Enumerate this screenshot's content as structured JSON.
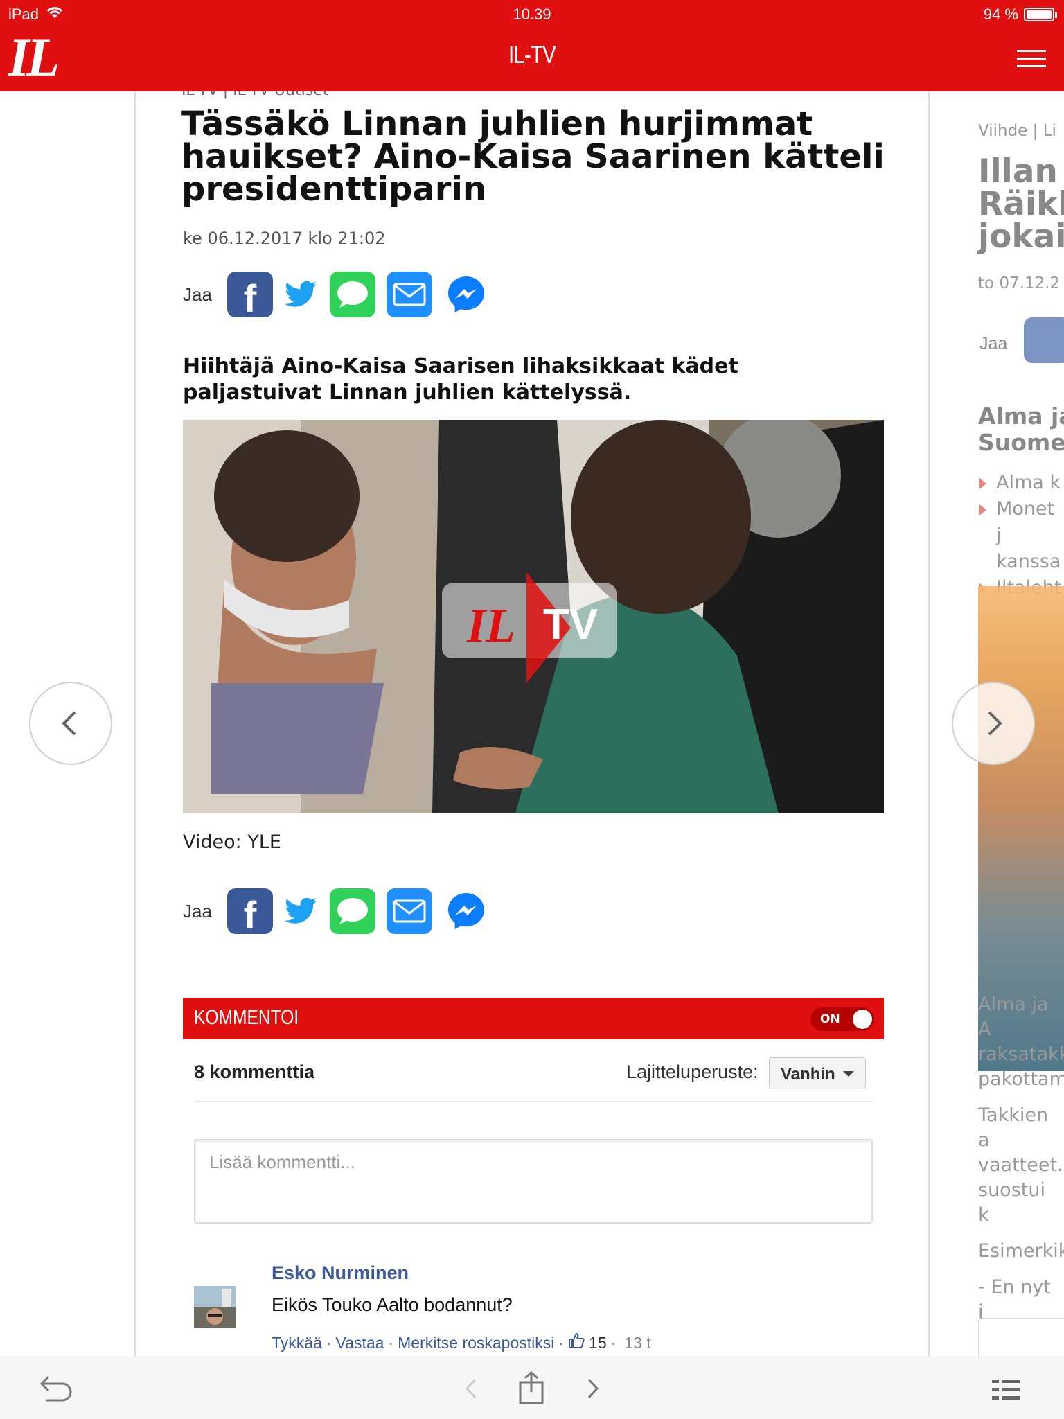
{
  "status_bar": {
    "device": "iPad",
    "time": "10.39",
    "battery": "94 %"
  },
  "header": {
    "logo": "IL",
    "title": "IL-TV"
  },
  "article": {
    "breadcrumb": "IL-TV | IL-TV Uutiset",
    "title": "Tässäkö Linnan juhlien hurjimmat hauikset? Aino-Kaisa Saarinen kätteli presidenttiparin",
    "date": "ke 06.12.2017 klo 21:02",
    "share_label": "Jaa",
    "lead": "Hiihtäjä Aino-Kaisa Saarisen lihaksikkaat kädet paljastuivat Linnan juhlien kättelyssä.",
    "video_watermark_left": "IL",
    "video_watermark_right": "TV",
    "caption": "Video: YLE"
  },
  "comments": {
    "header": "KOMMENTOI",
    "toggle": "ON",
    "count": "8 kommenttia",
    "sort_label": "Lajitteluperuste:",
    "sort_value": "Vanhin",
    "input_placeholder": "Lisää kommentti...",
    "items": [
      {
        "author": "Esko Nurminen",
        "text": "Eikös Touko Aalto bodannut?",
        "like": "Tykkää",
        "reply": "Vastaa",
        "report": "Merkitse roskapostiksi",
        "likes": "15",
        "age": "13 t"
      }
    ]
  },
  "next_article": {
    "breadcrumb": "Viihde | Li",
    "title_lines": [
      "Illan",
      "Räikk",
      "jokai"
    ],
    "date": "to 07.12.2",
    "share_label": "Jaa",
    "heading_lines": [
      "Alma ja",
      "Suome"
    ],
    "bullets": [
      "Alma k",
      "Monet j kanssa",
      "Iltaleht"
    ],
    "body": [
      "Alma ja A raksatakki pakottam",
      "Takkien a vaatteet. suostui k",
      "Esimerkik",
      "- En nyt j sanonpa varttunee pystyy, o"
    ]
  },
  "colors": {
    "brand_red": "#e01010",
    "facebook": "#3b5998",
    "twitter": "#1da1f2",
    "imessage": "#2fd158",
    "mail": "#1e90ff",
    "messenger": "#0a7cff"
  },
  "icons": {
    "back": "back-arrow-icon",
    "share": "share-icon",
    "list": "list-icon"
  }
}
